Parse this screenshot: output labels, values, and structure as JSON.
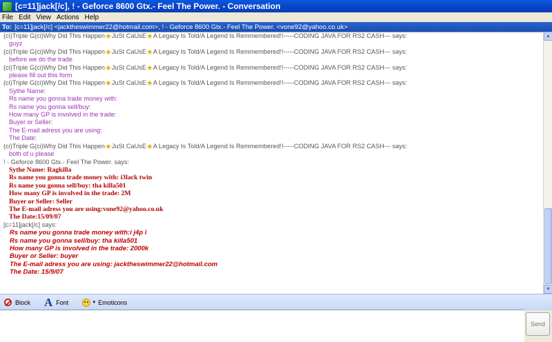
{
  "window": {
    "title": "[c=11]jack[/c], ! - Geforce 8600 Gtx.- Feel The Power. - Conversation"
  },
  "menu": [
    "File",
    "Edit",
    "View",
    "Actions",
    "Help"
  ],
  "to_bar": {
    "label": "To:",
    "recipients": "[c=11]jack[/c] <jacktheswimmer22@hotmail.com>, ! - Geforce 8600 Gtx.- Feel The Power. <vone92@yahoo.co.uk>"
  },
  "sender_triple": {
    "part1": "(ci)Triple G(ci)Why Did This Happen",
    "part2": "JuSt CaUsE",
    "part3": "A Legacy Is Told/A Legend Is Remmembered!!-----CODING JAVA FOR RS2 CASH--- says:"
  },
  "conversation": [
    {
      "sender": "triple",
      "lines": [
        "guyz"
      ]
    },
    {
      "sender": "triple",
      "lines": [
        "before we do the trade"
      ]
    },
    {
      "sender": "triple",
      "lines": [
        "please fill out this form"
      ]
    },
    {
      "sender": "triple",
      "lines": [
        "Sythe Name:",
        "Rs name you gonna trade money with:",
        "Rs name you gonna sell/buy:",
        "How many GP is involved in the trade:",
        "Buyer or Seller:",
        "The E-mail adress you are using:",
        "The Date:"
      ]
    },
    {
      "sender": "triple",
      "lines": [
        "both of u please"
      ]
    }
  ],
  "geforce": {
    "sender": "! - Geforce 8600 Gtx.- Feel The Power. says:",
    "lines": [
      "Sythe Name: Ragkilla",
      "Rs name you gonna trade money with: i3lack twin",
      "Rs name you gonna sell/buy: tha killa501",
      "How many GP is involved in the trade: 2M",
      "Buyer or Seller: Seller",
      "The E-mail adress you are using:vone92@yahoo.co.uk",
      "The Date:15/09/07"
    ]
  },
  "jack": {
    "sender": "[c=11]jack[/c] says:",
    "lines": [
      "Rs name you gonna trade money with:i j4p i",
      "Rs name you gonna sell/buy:  tha killa501",
      "How many GP is involved in the trade: 2000k",
      "Buyer or Seller: buyer",
      "The E-mail adress you are using: jacktheswimmer22@hotmail.com",
      "The Date: 15/9/07"
    ]
  },
  "toolbar": {
    "block": "Block",
    "font": "Font",
    "emoticons": "Emoticons"
  },
  "send_label": "Send"
}
